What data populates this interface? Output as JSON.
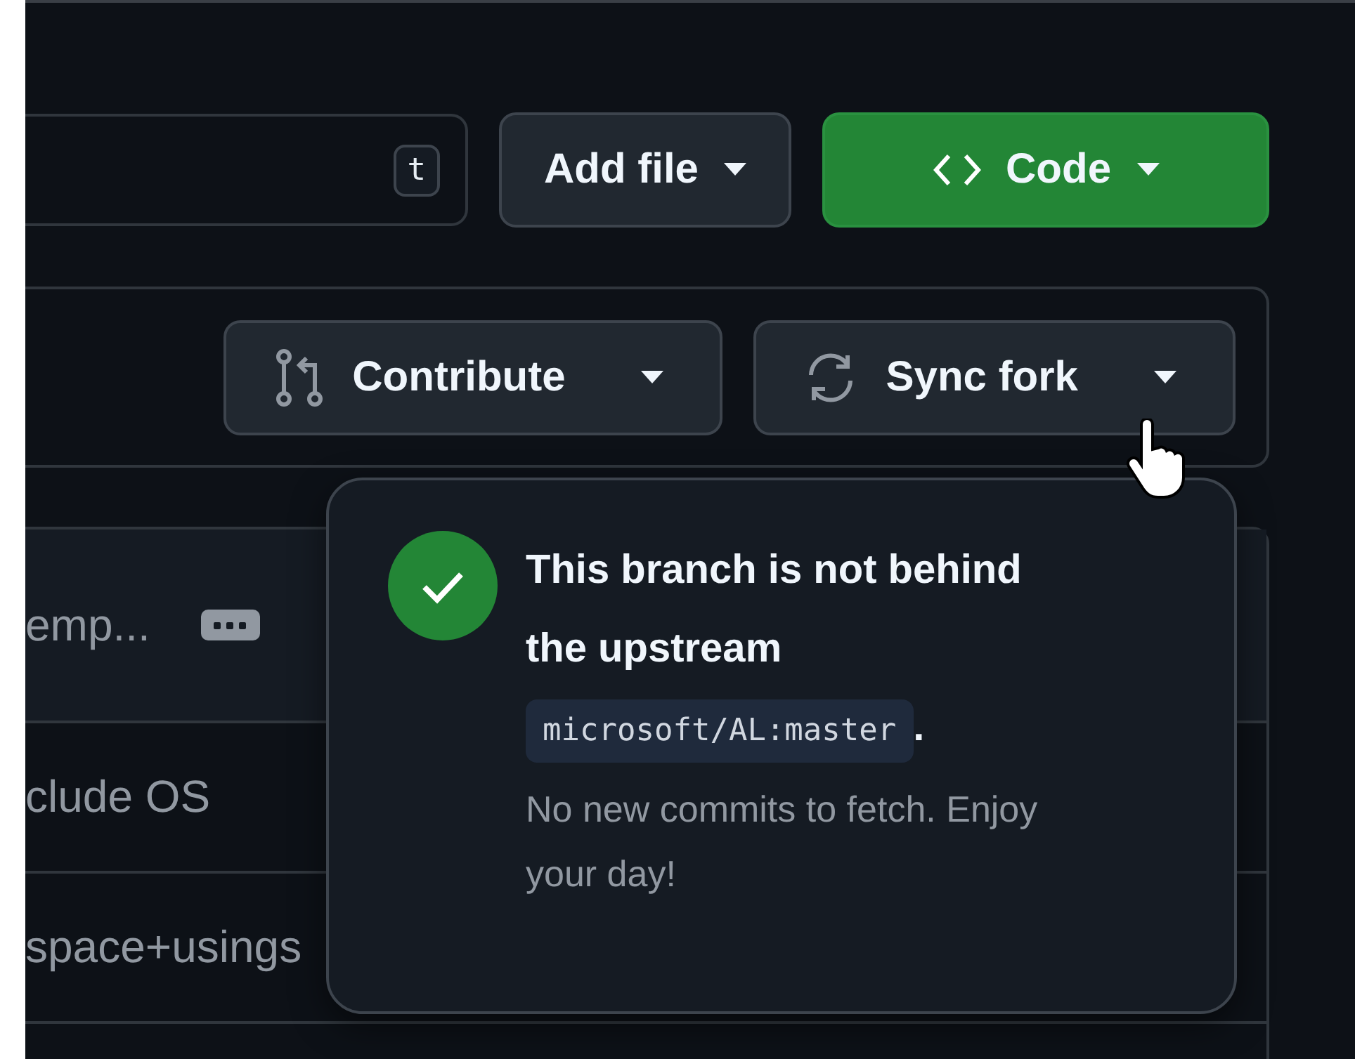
{
  "search": {
    "shortcut_key": "t"
  },
  "buttons": [
    {
      "label": "Add file",
      "kind": "default"
    },
    {
      "label": "Code",
      "kind": "primary"
    }
  ],
  "fork_bar": {
    "buttons": [
      {
        "label": "Contribute",
        "kind": "contribute"
      },
      {
        "label": "Sync fork",
        "kind": "sync"
      }
    ]
  },
  "files": [
    {
      "message": "emp...",
      "has_more": true
    },
    {
      "message": "clude OS"
    },
    {
      "message": "space+usings"
    }
  ],
  "popover": {
    "title": "This branch is not behind the upstream",
    "branch_ref": "microsoft/AL:master",
    "title_end": ".",
    "message": "No new commits to fetch. Enjoy your day!"
  }
}
